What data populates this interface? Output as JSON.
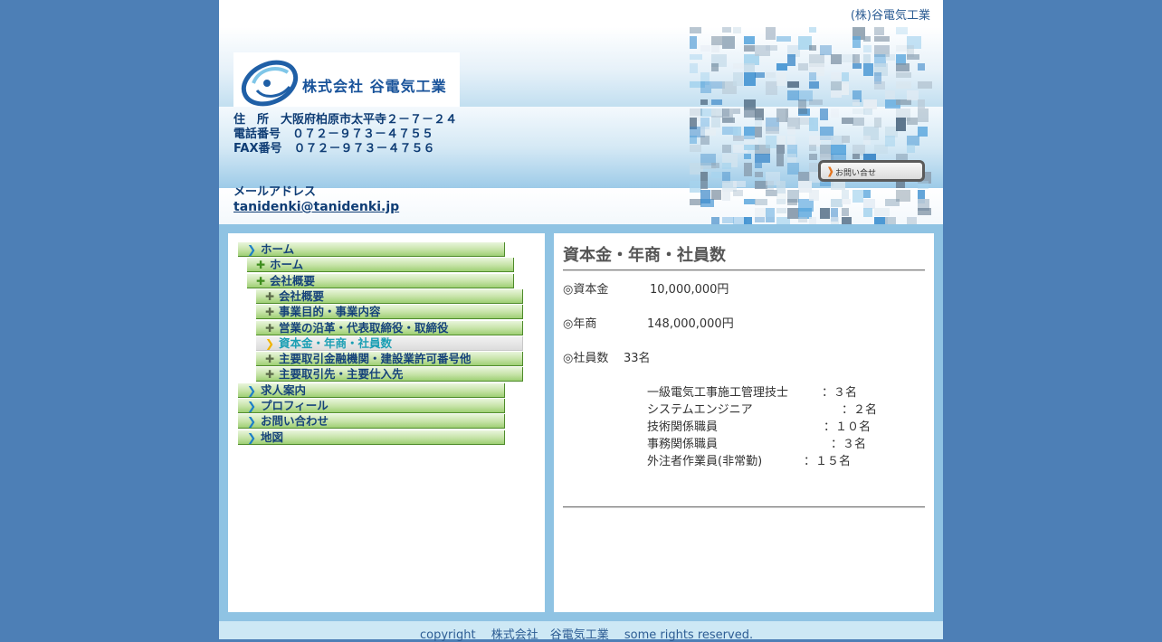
{
  "colors": {
    "page_background": "#4d7fb6",
    "frame": "#8fc3e3",
    "header_text": "#0f3d75",
    "nav_green": "#c6e3a7",
    "nav_active_text": "#1b9fb4",
    "contact_arrow": "#e3741f"
  },
  "header": {
    "company_tag": "(株)谷電気工業",
    "logo_text": "株式会社 谷電気工業",
    "address": "住　所　大阪府柏原市太平寺２－７－２４",
    "tel": "電話番号　０７２－９７３－４７５５",
    "fax": "FAX番号　０７２－９７３－４７５６",
    "mail_label": "メールアドレス",
    "mail": "tanidenki@tanidenki.jp",
    "contact_button": "お問い合せ"
  },
  "nav": {
    "items": [
      {
        "label": "ホーム",
        "icon": "chevron-right-icon",
        "level": 0,
        "active": false
      },
      {
        "label": "ホーム",
        "icon": "plus-icon",
        "level": 1,
        "active": false
      },
      {
        "label": "会社概要",
        "icon": "plus-icon",
        "level": 1,
        "active": false
      },
      {
        "label": "会社概要",
        "icon": "plus-icon",
        "level": 2,
        "active": false
      },
      {
        "label": "事業目的・事業内容",
        "icon": "plus-icon",
        "level": 2,
        "active": false
      },
      {
        "label": "営業の沿革・代表取締役・取締役",
        "icon": "plus-icon",
        "level": 2,
        "active": false
      },
      {
        "label": "資本金・年商・社員数",
        "icon": "chevron-right-icon",
        "level": 2,
        "active": true
      },
      {
        "label": "主要取引金融機関・建設業許可番号他",
        "icon": "plus-icon",
        "level": 2,
        "active": false
      },
      {
        "label": "主要取引先・主要仕入先",
        "icon": "plus-icon",
        "level": 2,
        "active": false
      },
      {
        "label": "求人案内",
        "icon": "chevron-right-icon",
        "level": 0,
        "active": false
      },
      {
        "label": "プロフィール",
        "icon": "chevron-right-icon",
        "level": 0,
        "active": false
      },
      {
        "label": "お問い合わせ",
        "icon": "chevron-right-icon",
        "level": 0,
        "active": false
      },
      {
        "label": "地図",
        "icon": "chevron-right-icon",
        "level": 0,
        "active": false
      }
    ]
  },
  "main": {
    "title": "資本金・年商・社員数",
    "capital_label": "◎資本金",
    "capital_value": "10,000,000円",
    "sales_label": "◎年商",
    "sales_value": "148,000,000円",
    "staff_label": "◎社員数",
    "staff_value": "33名",
    "staff_breakdown": [
      {
        "role": "一級電気工事施工管理技士",
        "count": "：３名"
      },
      {
        "role": "システムエンジニア",
        "count": "：２名"
      },
      {
        "role": "技術関係職員",
        "count": "：１０名"
      },
      {
        "role": "事務関係職員",
        "count": "：３名"
      },
      {
        "role": "外注者作業員(非常勤)",
        "count": "：１５名"
      }
    ]
  },
  "footer": {
    "text": "copyright　 株式会社　谷電気工業　 some rights reserved."
  }
}
